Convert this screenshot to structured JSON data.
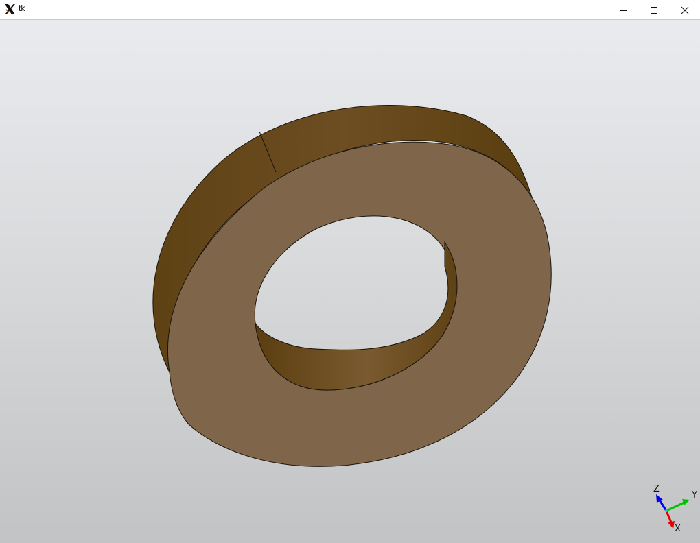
{
  "window": {
    "title": "tk",
    "controls": [
      "minimize",
      "maximize",
      "close"
    ]
  },
  "viewport": {
    "background_top": "#e9ebee",
    "background_bottom": "#c2c3c5",
    "model": {
      "shape": "washer",
      "face_color": "#7f654a",
      "side_color": "#6b4a1f",
      "edge_color": "#1a140c"
    }
  },
  "axis_triad": {
    "labels": {
      "x": "X",
      "y": "Y",
      "z": "Z"
    },
    "colors": {
      "x": "#e00000",
      "y": "#00c000",
      "z": "#0000e0"
    }
  }
}
